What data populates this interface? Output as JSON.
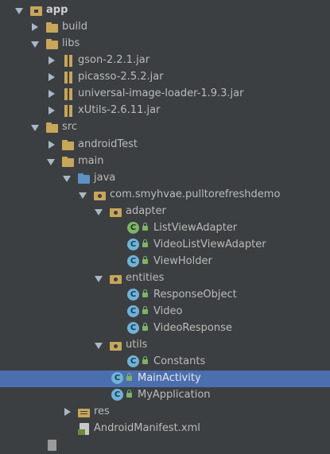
{
  "tree": {
    "app": "app",
    "build": "build",
    "libs": "libs",
    "jars": [
      "gson-2.2.1.jar",
      "picasso-2.5.2.jar",
      "universal-image-loader-1.9.3.jar",
      "xUtils-2.6.11.jar"
    ],
    "src": "src",
    "android_test": "androidTest",
    "main": "main",
    "java": "java",
    "package": "com.smyhvae.pulltorefreshdemo",
    "adapter": "adapter",
    "adapter_classes": [
      "ListViewAdapter",
      "VideoListViewAdapter",
      "ViewHolder"
    ],
    "entities": "entities",
    "entity_classes": [
      "ResponseObject",
      "Video",
      "VideoResponse"
    ],
    "utils": "utils",
    "util_classes": [
      "Constants"
    ],
    "activities": [
      "MainActivity",
      "MyApplication"
    ],
    "res": "res",
    "manifest": "AndroidManifest.xml",
    "class_glyph": "C",
    "selected_item": "MainActivity"
  },
  "colors": {
    "background": "#3c3f41",
    "selection": "#4b6eaf",
    "text": "#bbbbbb",
    "folder": "#c7a65a",
    "class_icon": "#6eb3d9"
  }
}
